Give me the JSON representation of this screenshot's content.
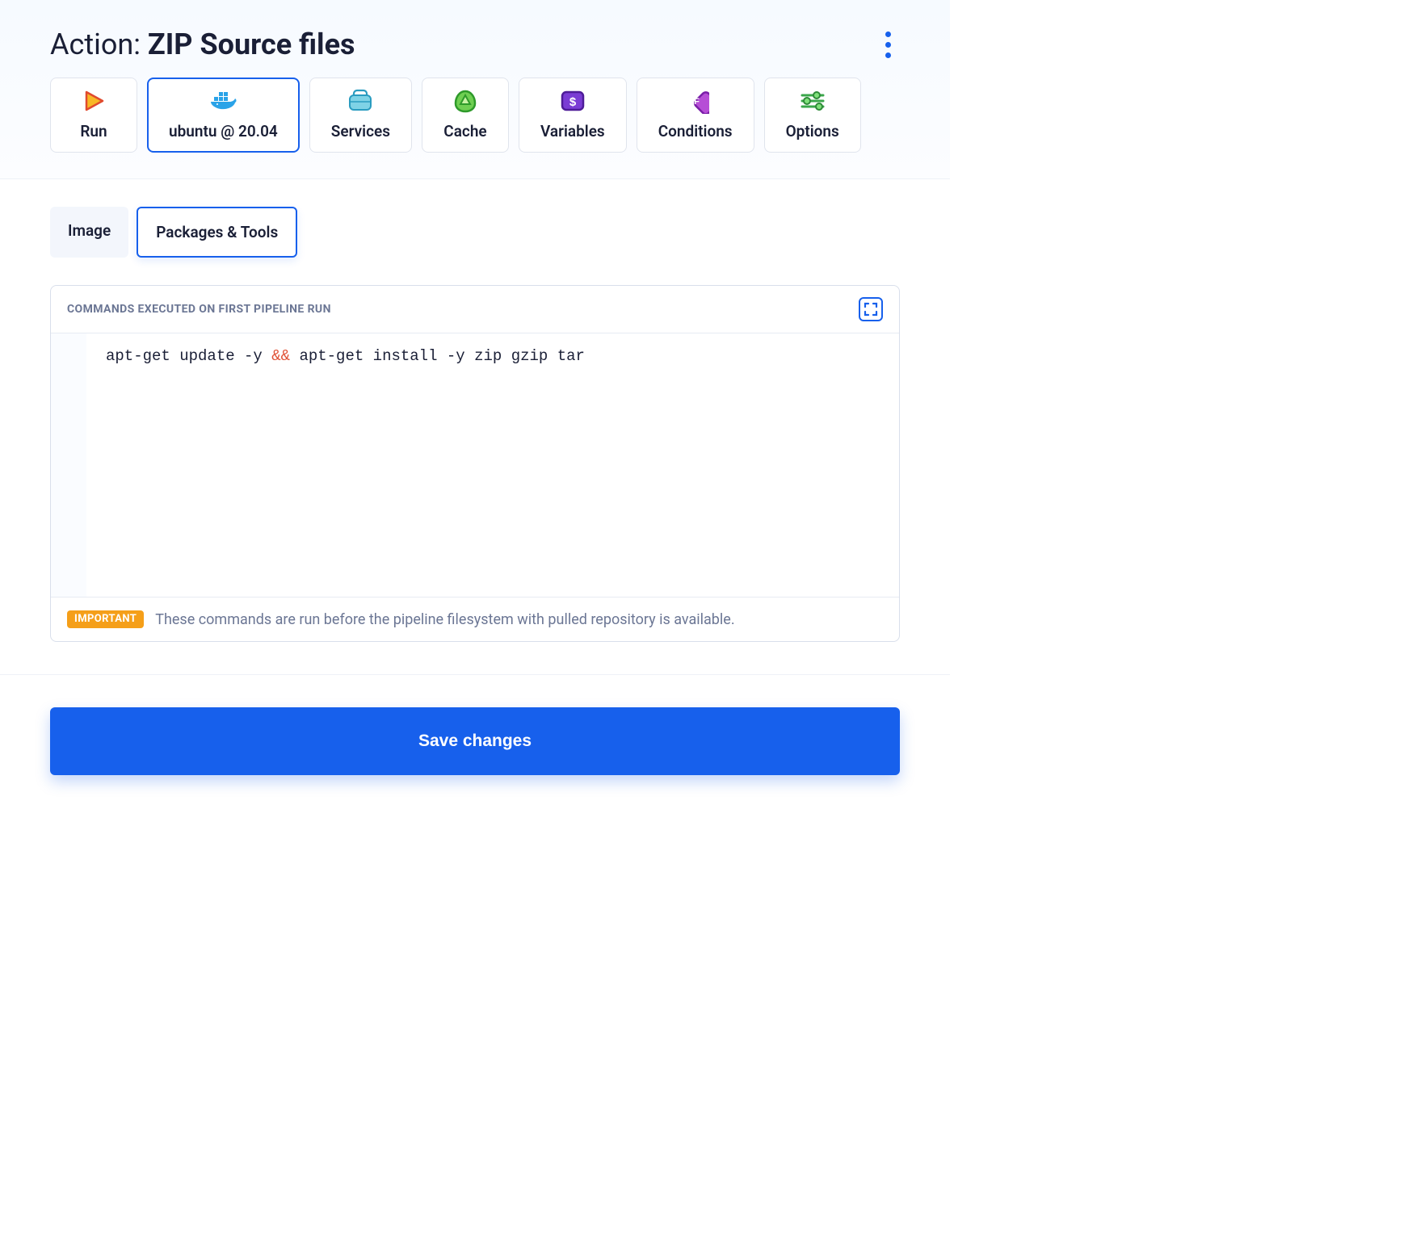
{
  "header": {
    "title_prefix": "Action: ",
    "title_strong": "ZIP Source files"
  },
  "main_tabs": [
    {
      "id": "run",
      "label": "Run",
      "active": false
    },
    {
      "id": "env",
      "label": "ubuntu @ 20.04",
      "active": true
    },
    {
      "id": "services",
      "label": "Services",
      "active": false
    },
    {
      "id": "cache",
      "label": "Cache",
      "active": false
    },
    {
      "id": "variables",
      "label": "Variables",
      "active": false
    },
    {
      "id": "conditions",
      "label": "Conditions",
      "active": false
    },
    {
      "id": "options",
      "label": "Options",
      "active": false
    }
  ],
  "sub_tabs": {
    "image": "Image",
    "packages": "Packages & Tools"
  },
  "editor": {
    "heading": "COMMANDS EXECUTED ON FIRST PIPELINE RUN",
    "code_plain": "apt-get update -y && apt-get install -y zip gzip tar",
    "code_left": "apt-get update -y ",
    "code_op": "&&",
    "code_right": " apt-get install -y zip gzip tar",
    "badge": "IMPORTANT",
    "note": "These commands are run before the pipeline filesystem with pulled repository is available."
  },
  "footer": {
    "save_label": "Save changes"
  }
}
